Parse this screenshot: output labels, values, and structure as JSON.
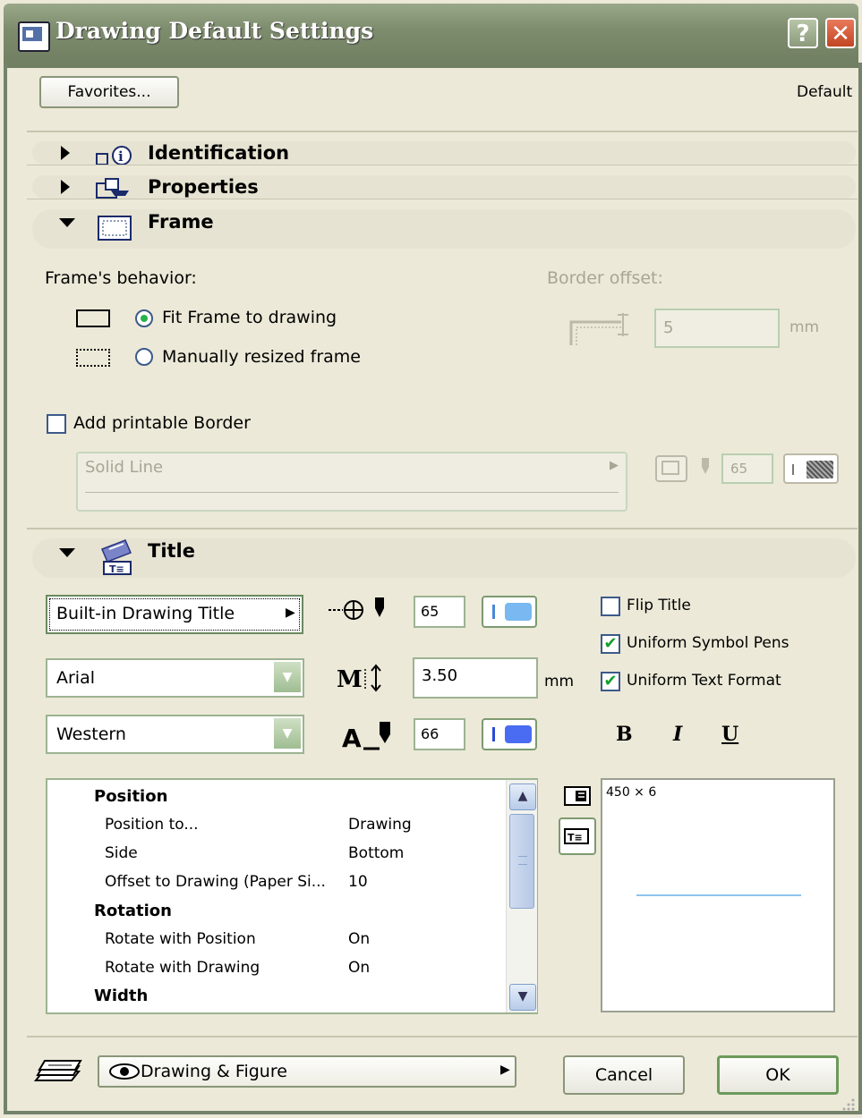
{
  "window": {
    "title": "Drawing Default Settings",
    "help_label": "?",
    "close_label": "✕"
  },
  "header": {
    "favorites_label": "Favorites...",
    "default_label": "Default"
  },
  "sections": {
    "identification": "Identification",
    "properties": "Properties",
    "frame": "Frame",
    "title": "Title"
  },
  "frame": {
    "behavior_label": "Frame's behavior:",
    "fit_label": "Fit Frame to drawing",
    "manual_label": "Manually resized frame",
    "fit_selected": true,
    "border_offset_label": "Border offset:",
    "border_offset_value": "5",
    "border_offset_unit": "mm",
    "add_border_label": "Add printable Border",
    "add_border_checked": false,
    "line_type": "Solid Line",
    "line_pen": "65"
  },
  "title_panel": {
    "title_type": "Built-in Drawing Title",
    "symbol_pen": "65",
    "font": "Arial",
    "text_size": "3.50",
    "text_size_unit": "mm",
    "script": "Western",
    "text_pen": "66",
    "flip_title_label": "Flip Title",
    "flip_title": false,
    "uniform_symbol_pens_label": "Uniform Symbol Pens",
    "uniform_symbol_pens": true,
    "uniform_text_format_label": "Uniform Text Format",
    "uniform_text_format": true,
    "bold": "B",
    "italic": "I",
    "underline": "U",
    "preview_text": "450 × 6",
    "params": [
      {
        "kind": "head",
        "label": "Position",
        "value": ""
      },
      {
        "kind": "item",
        "label": "Position to...",
        "value": "Drawing"
      },
      {
        "kind": "item",
        "label": "Side",
        "value": "Bottom"
      },
      {
        "kind": "item",
        "label": "Offset to Drawing (Paper Si...",
        "value": "10"
      },
      {
        "kind": "head",
        "label": "Rotation",
        "value": ""
      },
      {
        "kind": "item",
        "label": "Rotate with Position",
        "value": "On"
      },
      {
        "kind": "item",
        "label": "Rotate with Drawing",
        "value": "On"
      },
      {
        "kind": "head",
        "label": "Width",
        "value": ""
      }
    ]
  },
  "footer": {
    "layer_label": "Drawing & Figure",
    "cancel_label": "Cancel",
    "ok_label": "OK"
  },
  "colors": {
    "titlebar": "#7e8c6e",
    "accent_green": "#27b24a",
    "pen_blue": "#4a6cf2",
    "pen_light_blue": "#79b8f0",
    "close_red": "#d04e2c"
  }
}
